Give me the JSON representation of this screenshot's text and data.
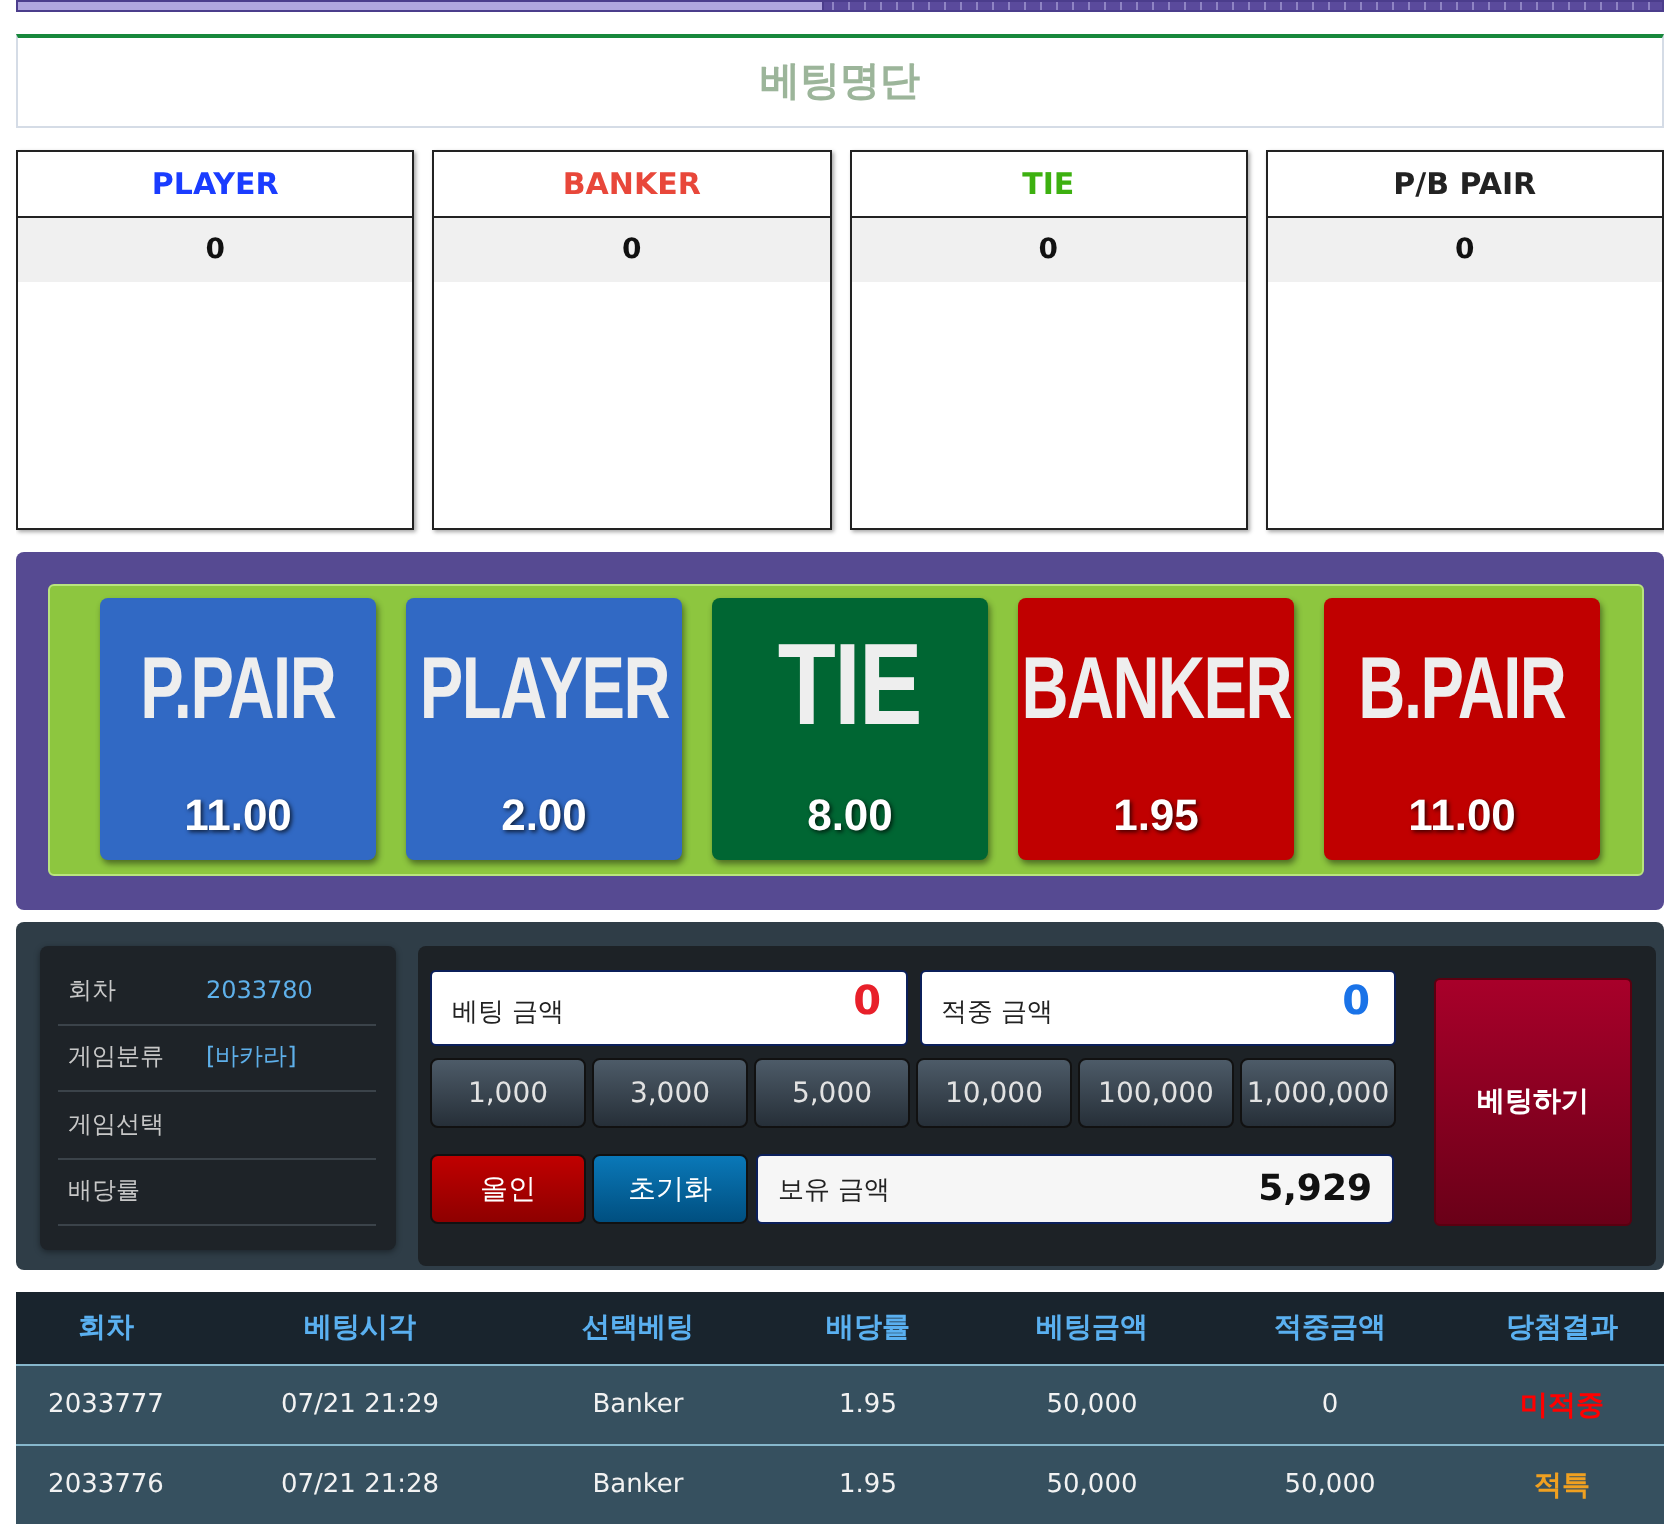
{
  "timer": {
    "level": 0.49
  },
  "title": "베팅명단",
  "bet_lists": [
    {
      "label": "PLAYER",
      "color": "#1a3cff",
      "count": "0"
    },
    {
      "label": "BANKER",
      "color": "#e8473a",
      "count": "0"
    },
    {
      "label": "TIE",
      "color": "#3db010",
      "count": "0"
    },
    {
      "label": "P/B PAIR",
      "color": "#222222",
      "count": "0"
    }
  ],
  "bet_options": [
    {
      "label": "P.PAIR",
      "odds": "11.00",
      "color": "#3169c4"
    },
    {
      "label": "PLAYER",
      "odds": "2.00",
      "color": "#3169c4"
    },
    {
      "label": "TIE",
      "odds": "8.00",
      "color": "#006633"
    },
    {
      "label": "BANKER",
      "odds": "1.95",
      "color": "#c00000"
    },
    {
      "label": "B.PAIR",
      "odds": "11.00",
      "color": "#c00000"
    }
  ],
  "round_info": [
    {
      "label": "회차",
      "value": "2033780"
    },
    {
      "label": "게임분류",
      "value": "[바카라]"
    },
    {
      "label": "게임선택"
    },
    {
      "label": "배당률"
    }
  ],
  "bet_amount": {
    "label": "베팅 금액",
    "value": "0"
  },
  "win_amount": {
    "label": "적중 금액",
    "value": "0"
  },
  "chips": [
    "1,000",
    "3,000",
    "5,000",
    "10,000",
    "100,000",
    "1,000,000"
  ],
  "all_in_button": "올인",
  "reset_button": "초기화",
  "balance": {
    "label": "보유 금액",
    "value": "5,929"
  },
  "place_bet_button": "베팅하기",
  "history": {
    "columns": [
      "회차",
      "베팅시각",
      "선택베팅",
      "배당률",
      "베팅금액",
      "적중금액",
      "당첨결과"
    ],
    "rows": [
      {
        "round": "2033777",
        "time": "07/21 21:29",
        "choice": "Banker",
        "odds": "1.95",
        "stake": "50,000",
        "payout": "0",
        "result": {
          "text": "미적중",
          "color": "#ff0000"
        }
      },
      {
        "round": "2033776",
        "time": "07/21 21:28",
        "choice": "Banker",
        "odds": "1.95",
        "stake": "50,000",
        "payout": "50,000",
        "result": {
          "text": "적특",
          "color": "#f0a020"
        }
      }
    ]
  }
}
